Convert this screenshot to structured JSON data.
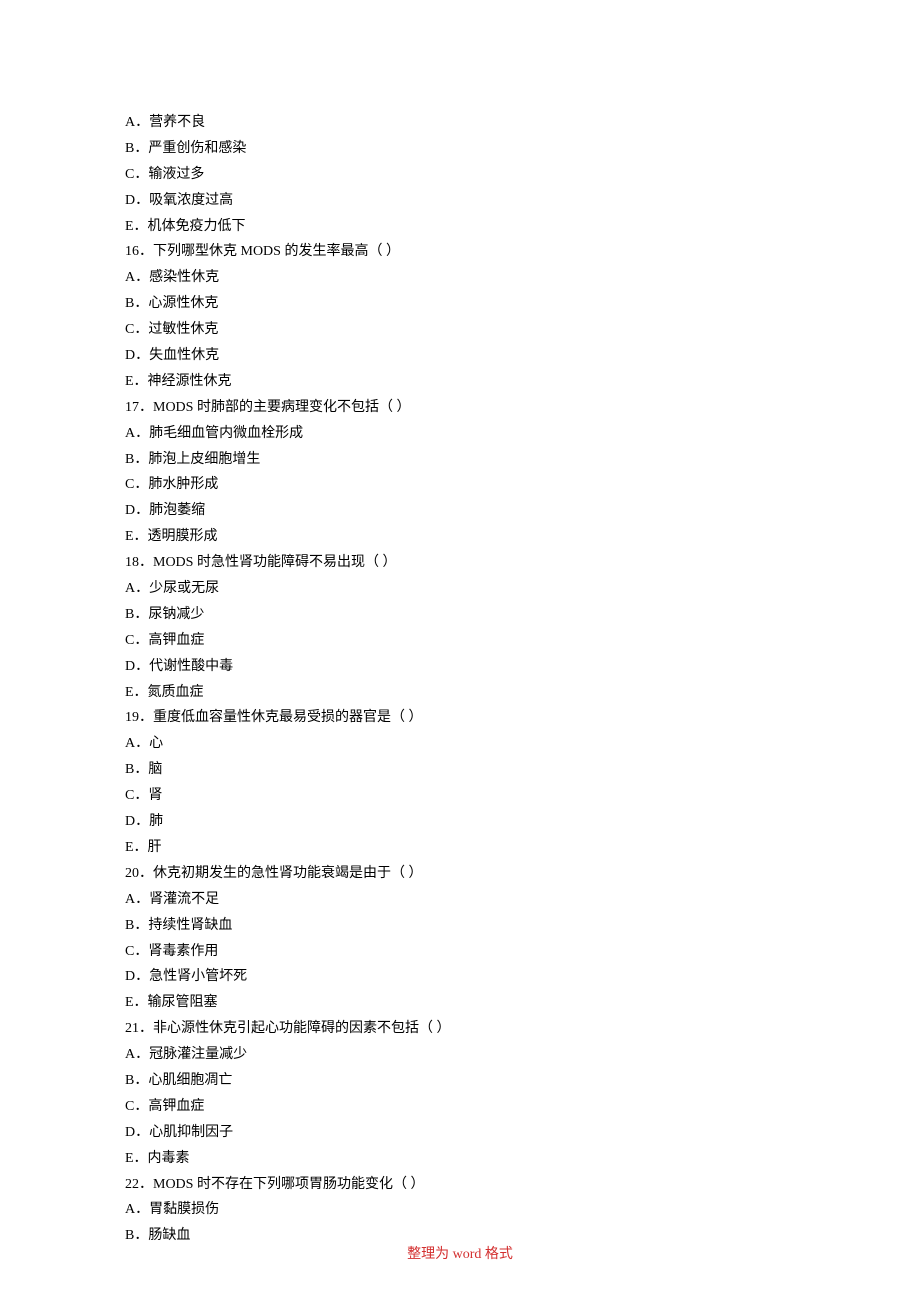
{
  "lines": [
    {
      "id": "opt-a-malnutrition",
      "text": "A．营养不良"
    },
    {
      "id": "opt-b-trauma-infection",
      "text": "B．严重创伤和感染"
    },
    {
      "id": "opt-c-overinfusion",
      "text": "C．输液过多"
    },
    {
      "id": "opt-d-high-oxygen",
      "text": "D．吸氧浓度过高"
    },
    {
      "id": "opt-e-low-immunity",
      "text": "E．机体免疫力低下"
    },
    {
      "id": "q16-stem",
      "text": "16．下列哪型休克 MODS 的发生率最高（ ）"
    },
    {
      "id": "q16-a",
      "text": "A．感染性休克"
    },
    {
      "id": "q16-b",
      "text": "B．心源性休克"
    },
    {
      "id": "q16-c",
      "text": "C．过敏性休克"
    },
    {
      "id": "q16-d",
      "text": "D．失血性休克"
    },
    {
      "id": "q16-e",
      "text": "E．神经源性休克"
    },
    {
      "id": "q17-stem",
      "text": "17．MODS 时肺部的主要病理变化不包括（ ）"
    },
    {
      "id": "q17-a",
      "text": "A．肺毛细血管内微血栓形成"
    },
    {
      "id": "q17-b",
      "text": "B．肺泡上皮细胞增生"
    },
    {
      "id": "q17-c",
      "text": "C．肺水肿形成"
    },
    {
      "id": "q17-d",
      "text": "D．肺泡萎缩"
    },
    {
      "id": "q17-e",
      "text": "E．透明膜形成"
    },
    {
      "id": "q18-stem",
      "text": "18．MODS 时急性肾功能障碍不易出现（ ）"
    },
    {
      "id": "q18-a",
      "text": "A．少尿或无尿"
    },
    {
      "id": "q18-b",
      "text": "B．尿钠减少"
    },
    {
      "id": "q18-c",
      "text": "C．高钾血症"
    },
    {
      "id": "q18-d",
      "text": "D．代谢性酸中毒"
    },
    {
      "id": "q18-e",
      "text": "E．氮质血症"
    },
    {
      "id": "q19-stem",
      "text": "19．重度低血容量性休克最易受损的器官是（ ）"
    },
    {
      "id": "q19-a",
      "text": "A．心"
    },
    {
      "id": "q19-b",
      "text": "B．脑"
    },
    {
      "id": "q19-c",
      "text": "C．肾"
    },
    {
      "id": "q19-d",
      "text": "D．肺"
    },
    {
      "id": "q19-e",
      "text": "E．肝"
    },
    {
      "id": "q20-stem",
      "text": "20．休克初期发生的急性肾功能衰竭是由于（ ）"
    },
    {
      "id": "q20-a",
      "text": "A．肾灌流不足"
    },
    {
      "id": "q20-b",
      "text": "B．持续性肾缺血"
    },
    {
      "id": "q20-c",
      "text": "C．肾毒素作用"
    },
    {
      "id": "q20-d",
      "text": "D．急性肾小管坏死"
    },
    {
      "id": "q20-e",
      "text": "E．输尿管阻塞"
    },
    {
      "id": "q21-stem",
      "text": "21．非心源性休克引起心功能障碍的因素不包括（ ）"
    },
    {
      "id": "q21-a",
      "text": "A．冠脉灌注量减少"
    },
    {
      "id": "q21-b",
      "text": "B．心肌细胞凋亡"
    },
    {
      "id": "q21-c",
      "text": "C．高钾血症"
    },
    {
      "id": "q21-d",
      "text": "D．心肌抑制因子"
    },
    {
      "id": "q21-e",
      "text": "E．内毒素"
    },
    {
      "id": "q22-stem",
      "text": "22．MODS 时不存在下列哪项胃肠功能变化（ ）"
    },
    {
      "id": "q22-a",
      "text": "A．胃黏膜损伤"
    },
    {
      "id": "q22-b",
      "text": "B．肠缺血"
    }
  ],
  "footer": {
    "prefix": "整理为",
    "word": " word ",
    "suffix": "格式"
  }
}
